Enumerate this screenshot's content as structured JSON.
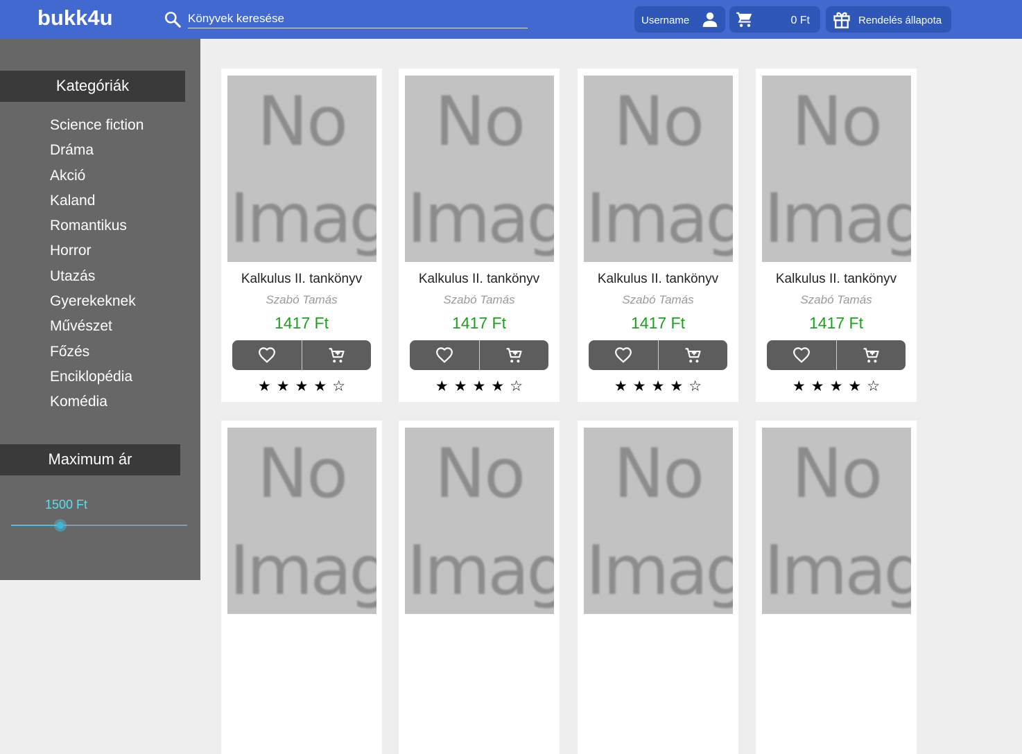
{
  "header": {
    "logo": "bukk4u",
    "search_placeholder": "Könyvek keresése",
    "username": "Username",
    "cart_total": "0 Ft",
    "order_status": "Rendelés állapota"
  },
  "sidebar": {
    "categories_heading": "Kategóriák",
    "categories": [
      "Science fiction",
      "Dráma",
      "Akció",
      "Kaland",
      "Romantikus",
      "Horror",
      "Utazás",
      "Gyerekeknek",
      "Művészet",
      "Főzés",
      "Enciklopédia",
      "Komédia"
    ],
    "price_heading": "Maximum ár",
    "max_price_label": "1500 Ft",
    "slider_fraction": 0.28
  },
  "placeholder_image": {
    "line1": "No",
    "line2": "Image"
  },
  "books": [
    {
      "title": "Kalkulus II. tankönyv",
      "author": "Szabó Tamás",
      "price": "1417 Ft",
      "rating": 4,
      "max_rating": 5
    },
    {
      "title": "Kalkulus II. tankönyv",
      "author": "Szabó Tamás",
      "price": "1417 Ft",
      "rating": 4,
      "max_rating": 5
    },
    {
      "title": "Kalkulus II. tankönyv",
      "author": "Szabó Tamás",
      "price": "1417 Ft",
      "rating": 4,
      "max_rating": 5
    },
    {
      "title": "Kalkulus II. tankönyv",
      "author": "Szabó Tamás",
      "price": "1417 Ft",
      "rating": 4,
      "max_rating": 5
    },
    {
      "title": "",
      "author": "",
      "price": "",
      "rating": 0,
      "max_rating": 5
    },
    {
      "title": "",
      "author": "",
      "price": "",
      "rating": 0,
      "max_rating": 5
    },
    {
      "title": "",
      "author": "",
      "price": "",
      "rating": 0,
      "max_rating": 5
    },
    {
      "title": "",
      "author": "",
      "price": "",
      "rating": 0,
      "max_rating": 5
    }
  ],
  "icons": {
    "search": "search-icon",
    "user": "user-icon",
    "cart": "cart-icon",
    "gift": "gift-icon",
    "favorite": "heart-icon",
    "add_to_cart": "cart-add-icon",
    "star_filled": "★",
    "star_empty": "☆"
  },
  "colors": {
    "header": "#4169d0",
    "header_pill": "#2f57b8",
    "sidebar": "#676767",
    "sidebar_heading": "#3a3a3a",
    "price": "#1aa31a",
    "slider_accent": "#3db8dd",
    "placeholder": "#c2c2c2"
  }
}
